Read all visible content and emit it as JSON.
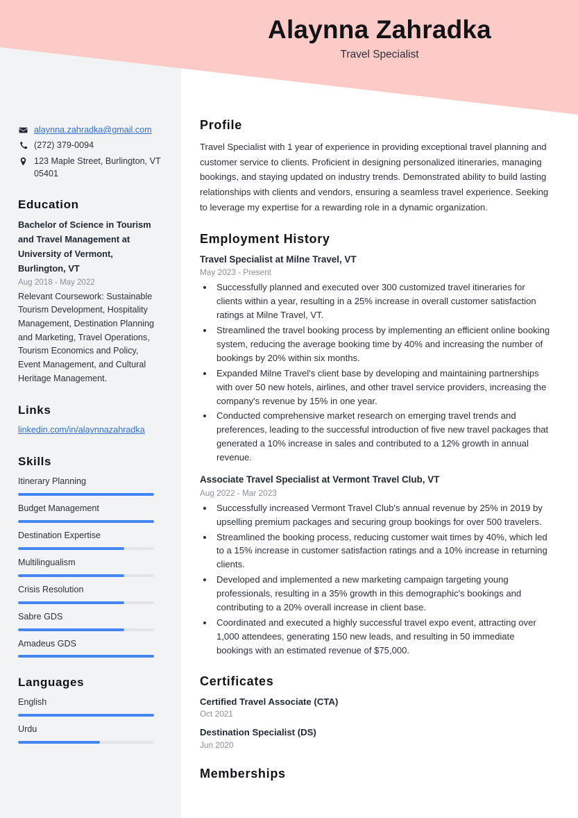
{
  "header": {
    "name": "Alaynna Zahradka",
    "job_title": "Travel Specialist",
    "banner_color": "#fccbc7"
  },
  "theme": {
    "accent_blue": "#4285f4",
    "link_blue": "#2f6fd0",
    "sidebar_bg": "#f2f3f5",
    "text_dark": "#1f2733",
    "text_muted": "#8a8f98"
  },
  "sidebar": {
    "contact": [
      {
        "icon": "envelope-icon",
        "text": "alaynna.zahradka@gmail.com",
        "is_link": true
      },
      {
        "icon": "phone-icon",
        "text": "(272) 379-0094",
        "is_link": false
      },
      {
        "icon": "location-pin-icon",
        "text": "123 Maple Street, Burlington, VT 05401",
        "is_link": false
      }
    ],
    "education": {
      "heading": "Education",
      "degree": "Bachelor of Science in Tourism and Travel Management at University of Vermont, Burlington, VT",
      "date": "Aug 2018 - May 2022",
      "description": "Relevant Coursework: Sustainable Tourism Development, Hospitality Management, Destination Planning and Marketing, Travel Operations, Tourism Economics and Policy, Event Management, and Cultural Heritage Management."
    },
    "links": {
      "heading": "Links",
      "items": [
        {
          "label": "linkedin.com/in/alaynnazahradka"
        }
      ]
    },
    "skills": {
      "heading": "Skills",
      "items": [
        {
          "label": "Itinerary Planning",
          "level": 100
        },
        {
          "label": "Budget Management",
          "level": 100
        },
        {
          "label": "Destination Expertise",
          "level": 78
        },
        {
          "label": "Multilingualism",
          "level": 78
        },
        {
          "label": "Crisis Resolution",
          "level": 78
        },
        {
          "label": "Sabre GDS",
          "level": 78
        },
        {
          "label": "Amadeus GDS",
          "level": 100
        }
      ]
    },
    "languages": {
      "heading": "Languages",
      "items": [
        {
          "label": "English",
          "level": 100
        },
        {
          "label": "Urdu",
          "level": 60
        }
      ]
    }
  },
  "main": {
    "profile": {
      "heading": "Profile",
      "text": "Travel Specialist with 1 year of experience in providing exceptional travel planning and customer service to clients. Proficient in designing personalized itineraries, managing bookings, and staying updated on industry trends. Demonstrated ability to build lasting relationships with clients and vendors, ensuring a seamless travel experience. Seeking to leverage my expertise for a rewarding role in a dynamic organization."
    },
    "employment": {
      "heading": "Employment History",
      "jobs": [
        {
          "title": "Travel Specialist at Milne Travel, VT",
          "date": "May 2023 - Present",
          "bullets": [
            "Successfully planned and executed over 300 customized travel itineraries for clients within a year, resulting in a 25% increase in overall customer satisfaction ratings at Milne Travel, VT.",
            "Streamlined the travel booking process by implementing an efficient online booking system, reducing the average booking time by 40% and increasing the number of bookings by 20% within six months.",
            "Expanded Milne Travel's client base by developing and maintaining partnerships with over 50 new hotels, airlines, and other travel service providers, increasing the company's revenue by 15% in one year.",
            "Conducted comprehensive market research on emerging travel trends and preferences, leading to the successful introduction of five new travel packages that generated a 10% increase in sales and contributed to a 12% growth in annual revenue."
          ]
        },
        {
          "title": "Associate Travel Specialist at Vermont Travel Club, VT",
          "date": "Aug 2022 - Mar 2023",
          "bullets": [
            "Successfully increased Vermont Travel Club's annual revenue by 25% in 2019 by upselling premium packages and securing group bookings for over 500 travelers.",
            "Streamlined the booking process, reducing customer wait times by 40%, which led to a 15% increase in customer satisfaction ratings and a 10% increase in returning clients.",
            "Developed and implemented a new marketing campaign targeting young professionals, resulting in a 35% growth in this demographic's bookings and contributing to a 20% overall increase in client base.",
            "Coordinated and executed a highly successful travel expo event, attracting over 1,000 attendees, generating 150 new leads, and resulting in 50 immediate bookings with an estimated revenue of $75,000."
          ]
        }
      ]
    },
    "certificates": {
      "heading": "Certificates",
      "items": [
        {
          "name": "Certified Travel Associate (CTA)",
          "date": "Oct 2021"
        },
        {
          "name": "Destination Specialist (DS)",
          "date": "Jun 2020"
        }
      ]
    },
    "memberships": {
      "heading": "Memberships"
    }
  }
}
